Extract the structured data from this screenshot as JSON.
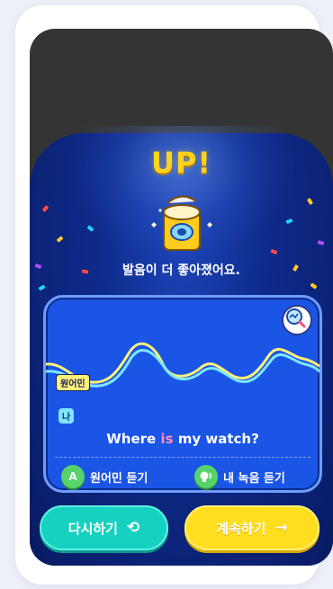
{
  "result": {
    "title": "UP!",
    "message": "발음이 더 좋아졌어요."
  },
  "comparison": {
    "native_tag": "원어민",
    "me_tag": "나",
    "sentence_before": "Where ",
    "sentence_highlight": "is",
    "sentence_after": " my watch?",
    "listen_native_icon": "A",
    "listen_native_label": "원어민 듣기",
    "listen_mine_label": "내 녹음 듣기"
  },
  "buttons": {
    "retry_label": "다시하기",
    "next_label": "계속하기"
  },
  "colors": {
    "title_yellow": "#ffd21e",
    "panel_blue": "#1a55e6",
    "native_wave": "#fff27a",
    "my_wave": "#7fe6ff",
    "highlight": "#ff8db6",
    "retry_button": "#17d1c0",
    "next_button": "#ffde1f"
  }
}
